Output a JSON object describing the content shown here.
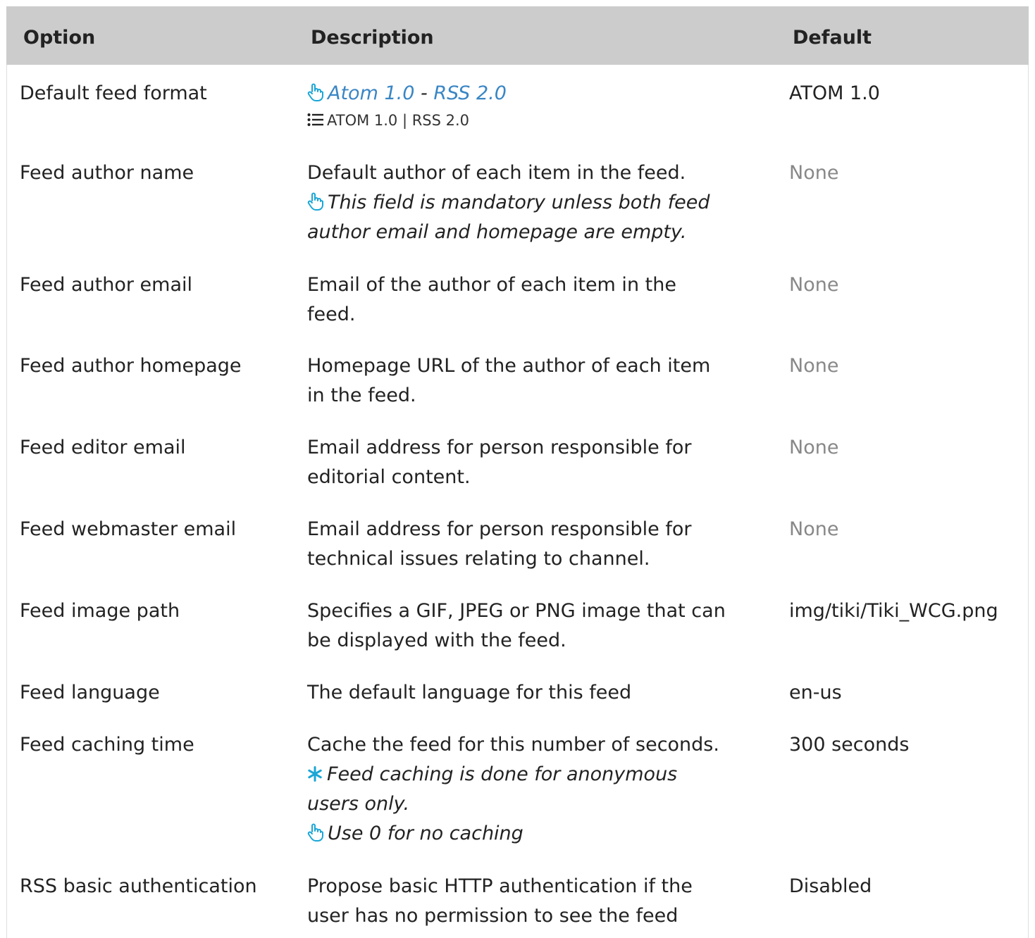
{
  "header": {
    "option": "Option",
    "description": "Description",
    "default": "Default"
  },
  "rows": [
    {
      "option": "Default feed format",
      "desc_link1": "Atom 1.0",
      "desc_sep": " - ",
      "desc_link2": "RSS 2.0",
      "desc_values": "ATOM 1.0 | RSS 2.0",
      "default": "ATOM 1.0"
    },
    {
      "option": "Feed author name",
      "desc_line1": "Default author of each item in the feed.",
      "tip_line1": "This field is mandatory unless both feed",
      "tip_line2": "author email and homepage are empty.",
      "default": "None"
    },
    {
      "option": "Feed author email",
      "desc_line1": "Email of the author of each item in the",
      "desc_line2": "feed.",
      "default": "None"
    },
    {
      "option": "Feed author homepage",
      "desc_line1": "Homepage URL of the author of each item",
      "desc_line2": "in the feed.",
      "default": "None"
    },
    {
      "option": "Feed editor email",
      "desc_line1": "Email address for person responsible for",
      "desc_line2": "editorial content.",
      "default": "None"
    },
    {
      "option": "Feed webmaster email",
      "desc_line1": "Email address for person responsible for",
      "desc_line2": "technical issues relating to channel.",
      "default": "None"
    },
    {
      "option": "Feed image path",
      "desc_line1": "Specifies a GIF, JPEG or PNG image that can",
      "desc_line2": "be displayed with the feed.",
      "default": "img/tiki/Tiki_WCG.png"
    },
    {
      "option": "Feed language",
      "desc_line1": "The default language for this feed",
      "default": "en-us"
    },
    {
      "option": "Feed caching time",
      "desc_line1": "Cache the feed for this number of seconds.",
      "warn_line1": "Feed caching is done for anonymous",
      "warn_line2": "users only.",
      "tip_line1": "Use 0 for no caching",
      "default": "300 seconds"
    },
    {
      "option": "RSS basic authentication",
      "desc_line1": "Propose basic HTTP authentication if the",
      "desc_line2": "user has no permission to see the feed",
      "default": "Disabled"
    }
  ],
  "icons": {
    "hand_pointer": "hand-pointer-icon",
    "list": "list-icon",
    "asterisk": "asterisk-icon"
  },
  "colors": {
    "header_bg": "#cccccc",
    "link": "#3a86c4",
    "icon_cyan": "#1aa6d6",
    "muted": "#888888"
  }
}
